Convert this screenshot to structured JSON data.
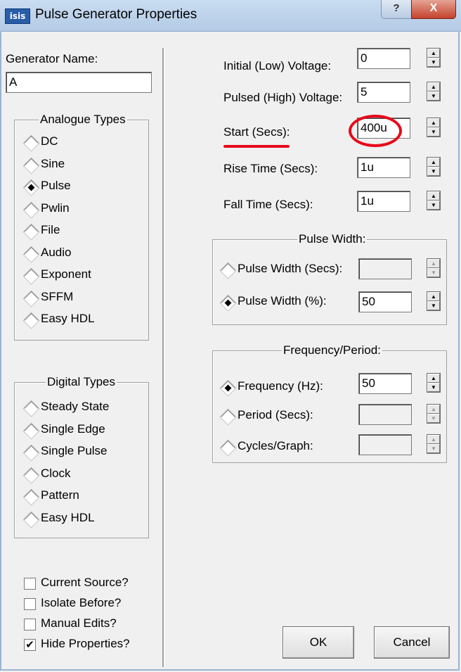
{
  "window": {
    "app_icon": "isis",
    "title": "Pulse Generator Properties",
    "help_label": "?",
    "close_label": "X"
  },
  "generator": {
    "name_label": "Generator Name:",
    "name_value": "A"
  },
  "analogue": {
    "legend": "Analogue Types",
    "types": [
      "DC",
      "Sine",
      "Pulse",
      "Pwlin",
      "File",
      "Audio",
      "Exponent",
      "SFFM",
      "Easy HDL"
    ],
    "selected": "Pulse"
  },
  "digital": {
    "legend": "Digital Types",
    "types": [
      "Steady State",
      "Single Edge",
      "Single Pulse",
      "Clock",
      "Pattern",
      "Easy HDL"
    ]
  },
  "options": {
    "current_source": {
      "label": "Current Source?",
      "checked": false
    },
    "isolate_before": {
      "label": "Isolate Before?",
      "checked": false
    },
    "manual_edits": {
      "label": "Manual Edits?",
      "checked": false
    },
    "hide_properties": {
      "label": "Hide Properties?",
      "checked": true,
      "mark": "✔"
    }
  },
  "params": {
    "initial_voltage": {
      "label": "Initial (Low) Voltage:",
      "value": "0"
    },
    "pulsed_voltage": {
      "label": "Pulsed (High) Voltage:",
      "value": "5"
    },
    "start": {
      "label": "Start (Secs):",
      "value": "400u"
    },
    "rise_time": {
      "label": "Rise Time (Secs):",
      "value": "1u"
    },
    "fall_time": {
      "label": "Fall Time (Secs):",
      "value": "1u"
    }
  },
  "pulse_width": {
    "legend": "Pulse Width:",
    "secs_label": "Pulse Width (Secs):",
    "secs_value": "",
    "percent_label": "Pulse Width (%):",
    "percent_value": "50",
    "selected": "percent"
  },
  "frequency": {
    "legend": "Frequency/Period:",
    "freq_label": "Frequency (Hz):",
    "freq_value": "50",
    "period_label": "Period (Secs):",
    "period_value": "",
    "cycles_label": "Cycles/Graph:",
    "cycles_value": "",
    "selected": "frequency"
  },
  "buttons": {
    "ok": "OK",
    "cancel": "Cancel"
  },
  "spinner_arrows": {
    "up": "▲",
    "down": "▼"
  },
  "colors": {
    "annotation_red": "#e8091a",
    "titlebar": "#b4cbe6",
    "close_button": "#c4422e"
  }
}
